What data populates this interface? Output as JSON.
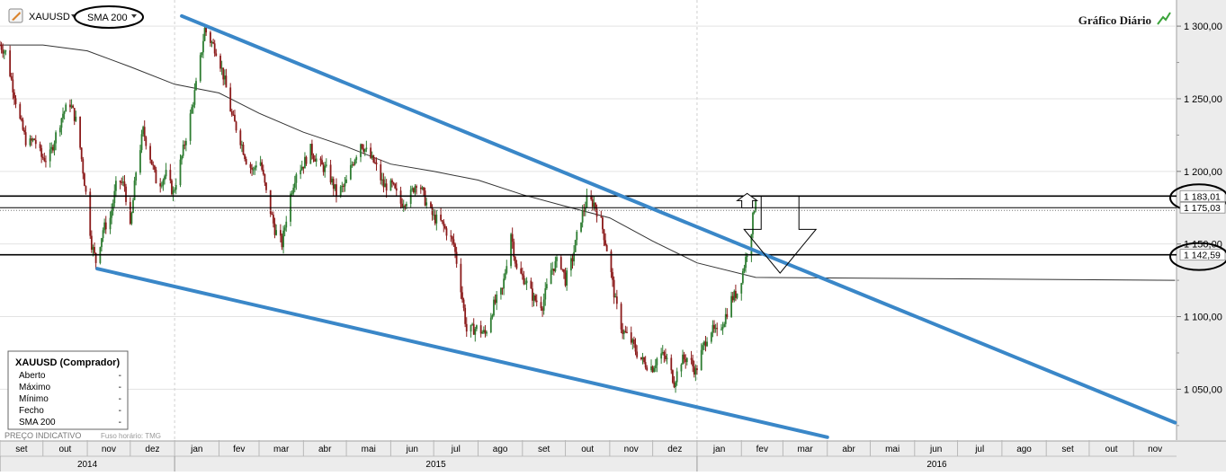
{
  "toolbar": {
    "symbol": "XAUUSD",
    "indicator": "SMA 200",
    "chart_title": "Gráfico Diário"
  },
  "info_box": {
    "title": "XAUUSD (Comprador)",
    "rows": [
      {
        "label": "Aberto",
        "value": "-"
      },
      {
        "label": "Máximo",
        "value": "-"
      },
      {
        "label": "Mínimo",
        "value": "-"
      },
      {
        "label": "Fecho",
        "value": "-"
      },
      {
        "label": "SMA 200",
        "value": "-"
      }
    ]
  },
  "footer": {
    "price_label": "PREÇO INDICATIVO",
    "timezone_label": "Fuso horário: TMG"
  },
  "colors": {
    "up": "#2e7d32",
    "down": "#8b1a1a",
    "trendline": "#3a87c8",
    "sma": "#333333",
    "level": "#000000",
    "price_axis_bg": "#ececec"
  },
  "chart_data": {
    "type": "candlestick",
    "instrument": "XAUUSD",
    "title": "Gráfico Diário",
    "ylim": [
      1015,
      1318
    ],
    "y_ticks": [
      {
        "value": 1050,
        "label": "1 050,00"
      },
      {
        "value": 1100,
        "label": "1 100,00"
      },
      {
        "value": 1150,
        "label": "1 150,00"
      },
      {
        "value": 1200,
        "label": "1 200,00"
      },
      {
        "value": 1250,
        "label": "1 250,00"
      },
      {
        "value": 1300,
        "label": "1 300,00"
      }
    ],
    "x_range": [
      "2014-09-01",
      "2016-12-01"
    ],
    "month_ticks": [
      {
        "date": "2014-09-01",
        "label": "set"
      },
      {
        "date": "2014-10-01",
        "label": "out"
      },
      {
        "date": "2014-11-01",
        "label": "nov"
      },
      {
        "date": "2014-12-01",
        "label": "dez"
      },
      {
        "date": "2015-01-01",
        "label": "jan"
      },
      {
        "date": "2015-02-01",
        "label": "fev"
      },
      {
        "date": "2015-03-01",
        "label": "mar"
      },
      {
        "date": "2015-04-01",
        "label": "abr"
      },
      {
        "date": "2015-05-01",
        "label": "mai"
      },
      {
        "date": "2015-06-01",
        "label": "jun"
      },
      {
        "date": "2015-07-01",
        "label": "jul"
      },
      {
        "date": "2015-08-01",
        "label": "ago"
      },
      {
        "date": "2015-09-01",
        "label": "set"
      },
      {
        "date": "2015-10-01",
        "label": "out"
      },
      {
        "date": "2015-11-01",
        "label": "nov"
      },
      {
        "date": "2015-12-01",
        "label": "dez"
      },
      {
        "date": "2016-01-01",
        "label": "jan"
      },
      {
        "date": "2016-02-01",
        "label": "fev"
      },
      {
        "date": "2016-03-01",
        "label": "mar"
      },
      {
        "date": "2016-04-01",
        "label": "abr"
      },
      {
        "date": "2016-05-01",
        "label": "mai"
      },
      {
        "date": "2016-06-01",
        "label": "jun"
      },
      {
        "date": "2016-07-01",
        "label": "jul"
      },
      {
        "date": "2016-08-01",
        "label": "ago"
      },
      {
        "date": "2016-09-01",
        "label": "set"
      },
      {
        "date": "2016-10-01",
        "label": "out"
      },
      {
        "date": "2016-11-01",
        "label": "nov"
      }
    ],
    "year_ticks": [
      {
        "start": "2014-09-01",
        "end": "2015-01-01",
        "label": "2014"
      },
      {
        "start": "2015-01-01",
        "end": "2016-01-01",
        "label": "2015"
      },
      {
        "start": "2016-01-01",
        "end": "2016-12-01",
        "label": "2016"
      }
    ],
    "price_path": [
      [
        "2014-09-01",
        1287
      ],
      [
        "2014-09-05",
        1282
      ],
      [
        "2014-09-10",
        1258
      ],
      [
        "2014-09-15",
        1235
      ],
      [
        "2014-09-20",
        1218
      ],
      [
        "2014-09-25",
        1222
      ],
      [
        "2014-09-30",
        1210
      ],
      [
        "2014-10-05",
        1208
      ],
      [
        "2014-10-10",
        1225
      ],
      [
        "2014-10-15",
        1240
      ],
      [
        "2014-10-20",
        1247
      ],
      [
        "2014-10-25",
        1232
      ],
      [
        "2014-10-31",
        1185
      ],
      [
        "2014-11-04",
        1150
      ],
      [
        "2014-11-07",
        1138
      ],
      [
        "2014-11-12",
        1160
      ],
      [
        "2014-11-17",
        1168
      ],
      [
        "2014-11-22",
        1195
      ],
      [
        "2014-11-27",
        1190
      ],
      [
        "2014-12-01",
        1160
      ],
      [
        "2014-12-05",
        1200
      ],
      [
        "2014-12-10",
        1228
      ],
      [
        "2014-12-15",
        1210
      ],
      [
        "2014-12-20",
        1190
      ],
      [
        "2014-12-26",
        1198
      ],
      [
        "2014-12-31",
        1185
      ],
      [
        "2015-01-06",
        1210
      ],
      [
        "2015-01-12",
        1238
      ],
      [
        "2015-01-18",
        1270
      ],
      [
        "2015-01-22",
        1298
      ],
      [
        "2015-01-26",
        1290
      ],
      [
        "2015-01-31",
        1282
      ],
      [
        "2015-02-05",
        1262
      ],
      [
        "2015-02-10",
        1238
      ],
      [
        "2015-02-15",
        1225
      ],
      [
        "2015-02-20",
        1208
      ],
      [
        "2015-02-25",
        1200
      ],
      [
        "2015-03-01",
        1212
      ],
      [
        "2015-03-06",
        1185
      ],
      [
        "2015-03-12",
        1160
      ],
      [
        "2015-03-17",
        1150
      ],
      [
        "2015-03-22",
        1180
      ],
      [
        "2015-03-27",
        1200
      ],
      [
        "2015-04-01",
        1205
      ],
      [
        "2015-04-06",
        1215
      ],
      [
        "2015-04-12",
        1205
      ],
      [
        "2015-04-18",
        1200
      ],
      [
        "2015-04-24",
        1185
      ],
      [
        "2015-04-30",
        1190
      ],
      [
        "2015-05-05",
        1205
      ],
      [
        "2015-05-11",
        1220
      ],
      [
        "2015-05-16",
        1212
      ],
      [
        "2015-05-21",
        1205
      ],
      [
        "2015-05-27",
        1190
      ],
      [
        "2015-06-02",
        1190
      ],
      [
        "2015-06-08",
        1178
      ],
      [
        "2015-06-14",
        1182
      ],
      [
        "2015-06-20",
        1195
      ],
      [
        "2015-06-25",
        1180
      ],
      [
        "2015-07-01",
        1168
      ],
      [
        "2015-07-06",
        1165
      ],
      [
        "2015-07-11",
        1157
      ],
      [
        "2015-07-15",
        1150
      ],
      [
        "2015-07-20",
        1120
      ],
      [
        "2015-07-24",
        1090
      ],
      [
        "2015-07-31",
        1092
      ],
      [
        "2015-08-06",
        1088
      ],
      [
        "2015-08-12",
        1108
      ],
      [
        "2015-08-18",
        1118
      ],
      [
        "2015-08-24",
        1158
      ],
      [
        "2015-08-28",
        1132
      ],
      [
        "2015-09-03",
        1125
      ],
      [
        "2015-09-09",
        1112
      ],
      [
        "2015-09-15",
        1108
      ],
      [
        "2015-09-21",
        1132
      ],
      [
        "2015-09-27",
        1140
      ],
      [
        "2015-10-01",
        1125
      ],
      [
        "2015-10-06",
        1140
      ],
      [
        "2015-10-11",
        1165
      ],
      [
        "2015-10-16",
        1180
      ],
      [
        "2015-10-21",
        1178
      ],
      [
        "2015-10-26",
        1165
      ],
      [
        "2015-10-31",
        1142
      ],
      [
        "2015-11-05",
        1110
      ],
      [
        "2015-11-10",
        1090
      ],
      [
        "2015-11-15",
        1085
      ],
      [
        "2015-11-20",
        1075
      ],
      [
        "2015-11-25",
        1068
      ],
      [
        "2015-12-01",
        1065
      ],
      [
        "2015-12-06",
        1075
      ],
      [
        "2015-12-11",
        1070
      ],
      [
        "2015-12-16",
        1055
      ],
      [
        "2015-12-21",
        1070
      ],
      [
        "2015-12-26",
        1072
      ],
      [
        "2015-12-31",
        1062
      ],
      [
        "2016-01-05",
        1078
      ],
      [
        "2016-01-10",
        1092
      ],
      [
        "2016-01-15",
        1088
      ],
      [
        "2016-01-20",
        1098
      ],
      [
        "2016-01-25",
        1112
      ],
      [
        "2016-01-30",
        1118
      ],
      [
        "2016-02-04",
        1140
      ],
      [
        "2016-02-08",
        1160
      ],
      [
        "2016-02-11",
        1183
      ]
    ],
    "sma200_path": [
      [
        "2014-09-01",
        1287
      ],
      [
        "2014-10-01",
        1287
      ],
      [
        "2014-11-01",
        1283
      ],
      [
        "2014-12-01",
        1272
      ],
      [
        "2015-01-01",
        1260
      ],
      [
        "2015-02-01",
        1254
      ],
      [
        "2015-03-01",
        1240
      ],
      [
        "2015-04-01",
        1227
      ],
      [
        "2015-05-01",
        1217
      ],
      [
        "2015-06-01",
        1205
      ],
      [
        "2015-07-01",
        1200
      ],
      [
        "2015-08-01",
        1194
      ],
      [
        "2015-09-01",
        1184
      ],
      [
        "2015-10-01",
        1176
      ],
      [
        "2015-11-01",
        1168
      ],
      [
        "2015-12-01",
        1152
      ],
      [
        "2016-01-01",
        1137
      ],
      [
        "2016-02-11",
        1127
      ],
      [
        "2016-11-30",
        1125
      ]
    ],
    "trendlines": [
      {
        "start": [
          "2015-01-06",
          1307
        ],
        "end": [
          "2016-11-30",
          1027
        ]
      },
      {
        "start": [
          "2014-11-08",
          1133
        ],
        "end": [
          "2016-04-01",
          1017
        ]
      }
    ],
    "levels": [
      {
        "value": 1183.01,
        "label": "1 183,01",
        "style": "solid",
        "highlighted": true
      },
      {
        "value": 1175.03,
        "label": "1 175,03",
        "style": "solid",
        "highlighted": false
      },
      {
        "value": 1142.59,
        "label": "1 142,59",
        "style": "solid",
        "highlighted": true
      }
    ],
    "annotations": [
      {
        "type": "arrow-up",
        "date": "2016-02-05",
        "value": 1183
      },
      {
        "type": "arrow-down",
        "date": "2016-02-28",
        "value": 1183,
        "target": 1130
      }
    ]
  }
}
